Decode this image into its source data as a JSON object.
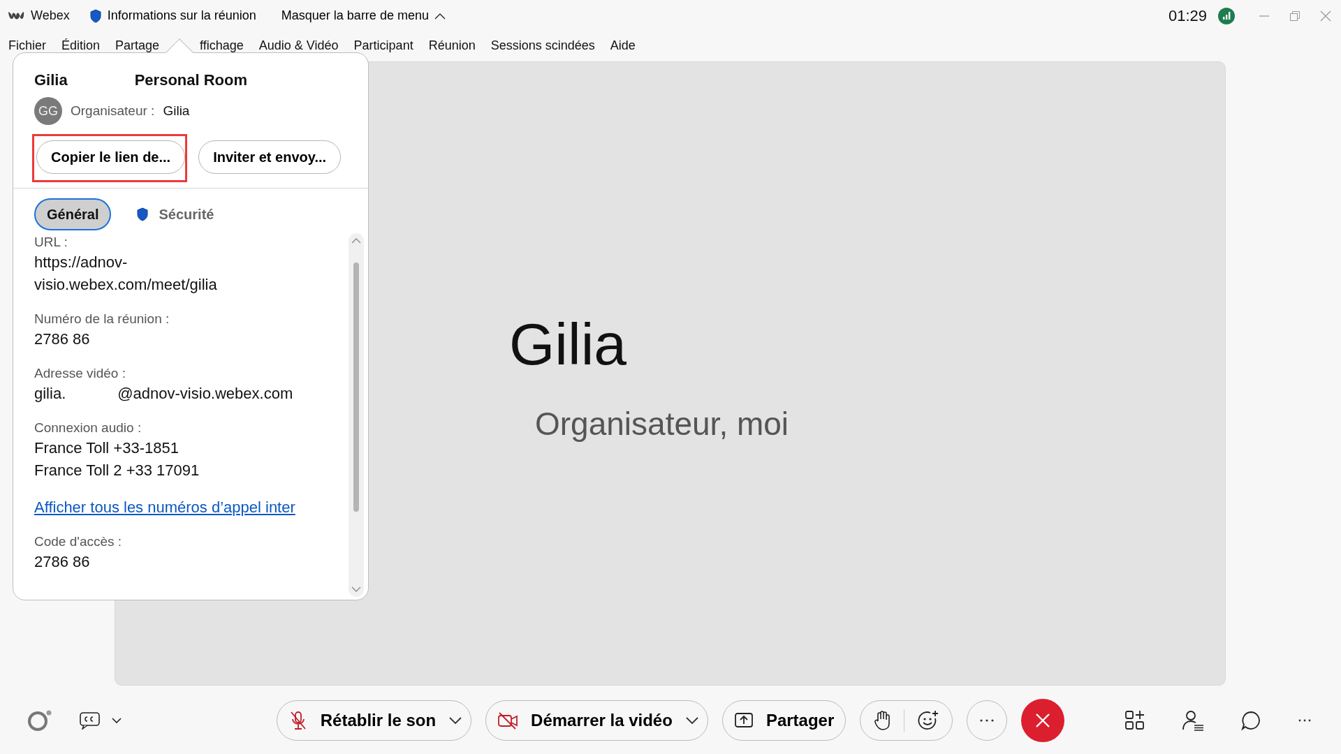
{
  "title_bar": {
    "app_name": "Webex",
    "meeting_info": "Informations sur la réunion",
    "hide_menu": "Masquer la barre de menu",
    "time": "01:29"
  },
  "menu": [
    "Fichier",
    "Édition",
    "Partage",
    "ffichage",
    "Audio & Vidéo",
    "Participant",
    "Réunion",
    "Sessions scindées",
    "Aide"
  ],
  "info_panel": {
    "title": "Gilia",
    "room": "Personal Room",
    "avatar_initials": "GG",
    "host_label": "Organisateur :",
    "host_name": "Gilia",
    "buttons": [
      {
        "label": "Copier le lien de...",
        "highlighted": true
      },
      {
        "label": "Inviter et envoy...",
        "highlighted": false
      }
    ],
    "tabs": [
      {
        "label": "Général",
        "selected": true
      },
      {
        "label": "Sécurité",
        "selected": false
      }
    ],
    "details": [
      {
        "kind": "field",
        "label": "URL :",
        "lines": [
          "https://adnov-",
          "visio.webex.com/meet/gilia"
        ]
      },
      {
        "kind": "field",
        "label": "Numéro de la réunion :",
        "lines": [
          "2786 86"
        ]
      },
      {
        "kind": "split",
        "label": "Adresse vidéo :",
        "parts": [
          "gilia.",
          "@adnov-visio.webex.com"
        ]
      },
      {
        "kind": "field",
        "label": "Connexion audio :",
        "lines": [
          "France Toll +33-1851",
          "France Toll 2 +33 17091"
        ]
      },
      {
        "kind": "link",
        "text": "Afficher tous les numéros d’appel inter"
      },
      {
        "kind": "field",
        "label": "Code d'accès :",
        "lines": [
          "2786 86"
        ]
      }
    ]
  },
  "stage": {
    "name": "Gilia",
    "role": "Organisateur, moi"
  },
  "controls": {
    "audio": {
      "label": "Rétablir le son",
      "muted": true
    },
    "video": {
      "label": "Démarrer la vidéo",
      "on": false
    },
    "share": {
      "label": "Partager"
    }
  }
}
